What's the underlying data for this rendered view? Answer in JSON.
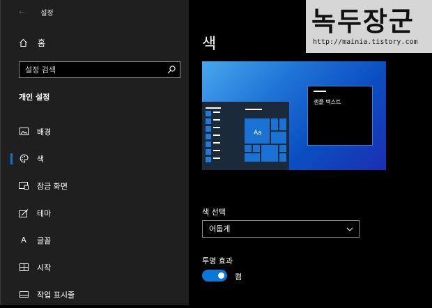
{
  "window": {
    "title": "설정"
  },
  "sidebar": {
    "home_label": "홈",
    "search_placeholder": "설정 검색",
    "section_title": "개인 설정",
    "items": [
      {
        "label": "배경",
        "icon": "picture-icon"
      },
      {
        "label": "색",
        "icon": "palette-icon",
        "active": true
      },
      {
        "label": "잠금 화면",
        "icon": "lock-screen-icon"
      },
      {
        "label": "테마",
        "icon": "theme-icon"
      },
      {
        "label": "글꼴",
        "icon": "font-icon"
      },
      {
        "label": "시작",
        "icon": "start-icon"
      },
      {
        "label": "작업 표시줄",
        "icon": "taskbar-icon"
      }
    ]
  },
  "main": {
    "title": "색",
    "preview": {
      "sample_text": "샘플 텍스트",
      "tile_text": "Aa"
    },
    "color_select_label": "색 선택",
    "color_select_value": "어둡게",
    "transparency_label": "투명 효과",
    "transparency_state": "켬",
    "transparency_on": true
  },
  "watermark": {
    "title": "녹두장군",
    "url": "http://mainia.tistory.com"
  },
  "colors": {
    "accent": "#0a78d7",
    "sidebar_bg": "#1f1f1f",
    "main_bg": "#000000"
  }
}
